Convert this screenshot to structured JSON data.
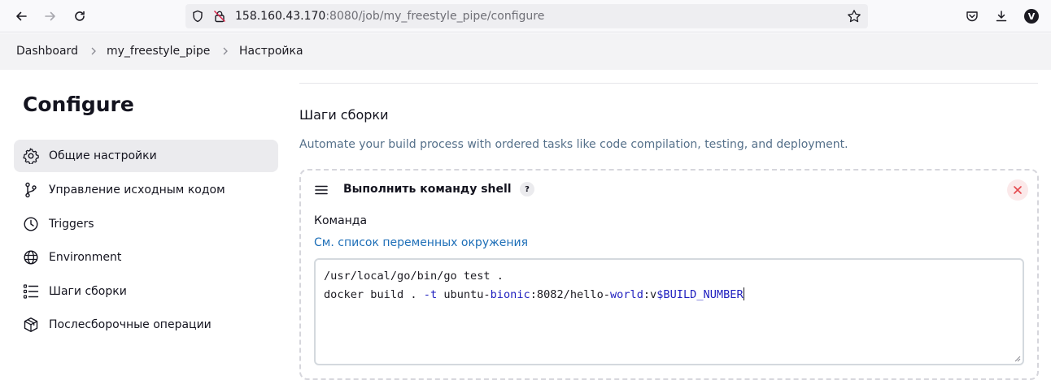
{
  "browser": {
    "url_host": "158.160.43.170",
    "url_rest": ":8080/job/my_freestyle_pipe/configure",
    "avatar_letter": "V"
  },
  "breadcrumb": {
    "items": [
      "Dashboard",
      "my_freestyle_pipe",
      "Настройка"
    ]
  },
  "sidebar": {
    "title": "Configure",
    "items": [
      {
        "label": "Общие настройки",
        "icon": "gear-icon",
        "active": true
      },
      {
        "label": "Управление исходным кодом",
        "icon": "branch-icon",
        "active": false
      },
      {
        "label": "Triggers",
        "icon": "clock-icon",
        "active": false
      },
      {
        "label": "Environment",
        "icon": "globe-icon",
        "active": false
      },
      {
        "label": "Шаги сборки",
        "icon": "list-icon",
        "active": false
      },
      {
        "label": "Послесборочные операции",
        "icon": "package-icon",
        "active": false
      }
    ]
  },
  "main": {
    "section_title": "Шаги сборки",
    "section_desc": "Automate your build process with ordered tasks like code compilation, testing, and deployment.",
    "step": {
      "title": "Выполнить команду shell",
      "help": "?",
      "field_label": "Команда",
      "env_prefix": "См.",
      "env_link": "список переменных окружения",
      "command_line1": "/usr/local/go/bin/go test .",
      "command_line2_parts": [
        "docker build . ",
        "-t",
        " ubuntu-",
        "bionic",
        ":8082/hello-",
        "world",
        ":v",
        "$BUILD_NUMBER"
      ]
    }
  },
  "colors": {
    "accent_link": "#1e6fb8",
    "desc_text": "#55708a",
    "close_red": "#e5484d",
    "active_bg": "#ebebee"
  }
}
